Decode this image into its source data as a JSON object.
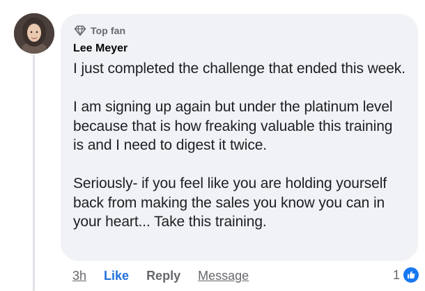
{
  "comment": {
    "badge_label": "Top fan",
    "badge_icon": "diamond-icon",
    "author": "Lee Meyer",
    "paragraphs": [
      "I just completed the challenge that ended this week.",
      "I am signing up again but under the platinum level because that is how freaking valuable this training is and I need to digest it twice.",
      "Seriously- if you feel like you are holding yourself back from making the sales you know you can in your heart... Take this training."
    ]
  },
  "actions": {
    "timestamp": "3h",
    "like": "Like",
    "reply": "Reply",
    "message": "Message"
  },
  "reactions": {
    "count": "1",
    "icon": "like-reaction-icon"
  },
  "colors": {
    "bubble": "#f0f2f5",
    "like_blue": "#216fdb",
    "secondary_text": "#65676b"
  }
}
